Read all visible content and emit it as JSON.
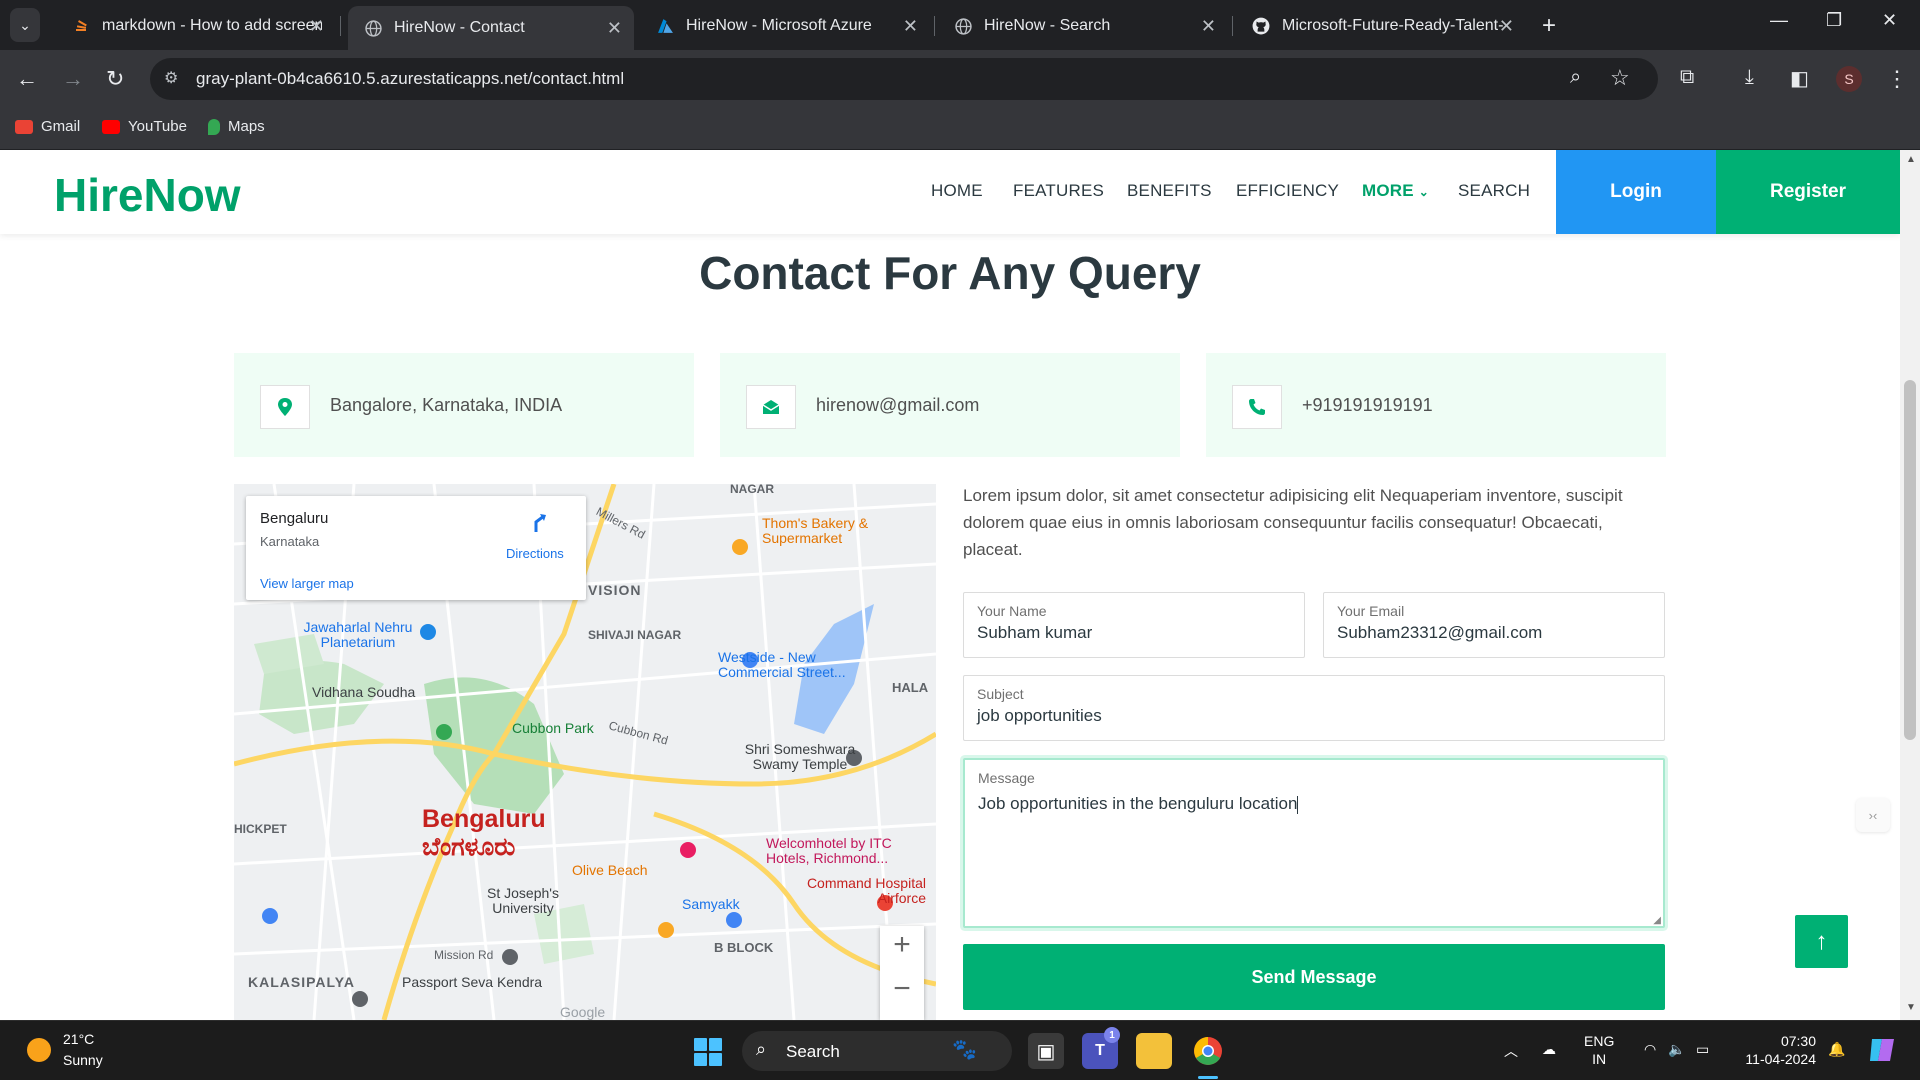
{
  "browser": {
    "tabs": [
      {
        "title": "markdown - How to add screen",
        "icon": "stackoverflow-icon",
        "active": false
      },
      {
        "title": "HireNow - Contact",
        "icon": "globe-icon",
        "active": true
      },
      {
        "title": "HireNow - Microsoft Azure",
        "icon": "azure-icon",
        "active": false
      },
      {
        "title": "HireNow - Search",
        "icon": "globe-icon",
        "active": false
      },
      {
        "title": "Microsoft-Future-Ready-Talent-",
        "icon": "github-icon",
        "active": false
      }
    ],
    "url_host": "gray-plant-0b4ca6610.5.azurestaticapps.net",
    "url_path": "/contact.html",
    "profile_initial": "S",
    "bookmarks": [
      {
        "label": "Gmail",
        "icon": "gmail-icon",
        "color": "#ea4335"
      },
      {
        "label": "YouTube",
        "icon": "youtube-icon",
        "color": "#ff0000"
      },
      {
        "label": "Maps",
        "icon": "maps-icon",
        "color": "#34a853"
      }
    ]
  },
  "site": {
    "brand": "HireNow",
    "nav": [
      {
        "label": "HOME"
      },
      {
        "label": "FEATURES"
      },
      {
        "label": "BENEFITS"
      },
      {
        "label": "EFFICIENCY"
      },
      {
        "label": "MORE"
      },
      {
        "label": "SEARCH"
      }
    ],
    "login_label": "Login",
    "register_label": "Register",
    "brand_color": "#00b074",
    "login_color": "#2196f3"
  },
  "contact": {
    "heading": "Contact For Any Query",
    "cards": [
      {
        "icon": "location-pin-icon",
        "text": "Bangalore, Karnataka, INDIA"
      },
      {
        "icon": "envelope-open-icon",
        "text": "hirenow@gmail.com"
      },
      {
        "icon": "phone-icon",
        "text": "+919191919191"
      }
    ],
    "intro": "Lorem ipsum dolor, sit amet consectetur adipisicing elit Nequaperiam inventore, suscipit dolorem quae eius in omnis laboriosam consequuntur facilis consequatur! Obcaecati, placeat.",
    "form": {
      "name_label": "Your Name",
      "name_value": "Subham kumar",
      "email_label": "Your Email",
      "email_value": "Subham23312@gmail.com",
      "subject_label": "Subject",
      "subject_value": "job opportunities",
      "message_label": "Message",
      "message_value": "Job opportunities in the benguluru location",
      "send_label": "Send Message"
    }
  },
  "map": {
    "place_title": "Bengaluru",
    "place_region": "Karnataka",
    "directions_label": "Directions",
    "larger_map_label": "View larger map",
    "city_label_en": "Bengaluru",
    "city_label_kn": "ಬೆಂಗಳೂರು",
    "labels": {
      "nagar": "NAGAR",
      "millers": "Millers Rd",
      "thoms": "Thom's Bakery & Supermarket",
      "vision": "VISION",
      "jawaharlal": "Jawaharlal Nehru Planetarium",
      "shivaji": "SHIVAJI NAGAR",
      "westside": "Westside - New Commercial Street...",
      "hala": "HALA",
      "vidhana": "Vidhana Soudha",
      "cubbon_park": "Cubbon Park",
      "cubbon_rd": "Cubbon Rd",
      "someshwara": "Shri Someshwara Swamy Temple",
      "welcomhotel": "Welcomhotel by ITC Hotels, Richmond...",
      "olive": "Olive Beach",
      "command": "Command Hospital Airforce",
      "stjoseph": "St Joseph's University",
      "samyakk": "Samyakk",
      "bblock": "B BLOCK",
      "mission": "Mission Rd",
      "kalasipalya": "KALASIPALYA",
      "passport": "Passport Seva Kendra",
      "google": "Google",
      "hickpet": "HICKPET"
    }
  },
  "taskbar": {
    "temperature": "21°C",
    "weather": "Sunny",
    "search_label": "Search",
    "teams_badge": "1",
    "lang_line1": "ENG",
    "lang_line2": "IN",
    "time": "07:30",
    "date": "11-04-2024"
  }
}
